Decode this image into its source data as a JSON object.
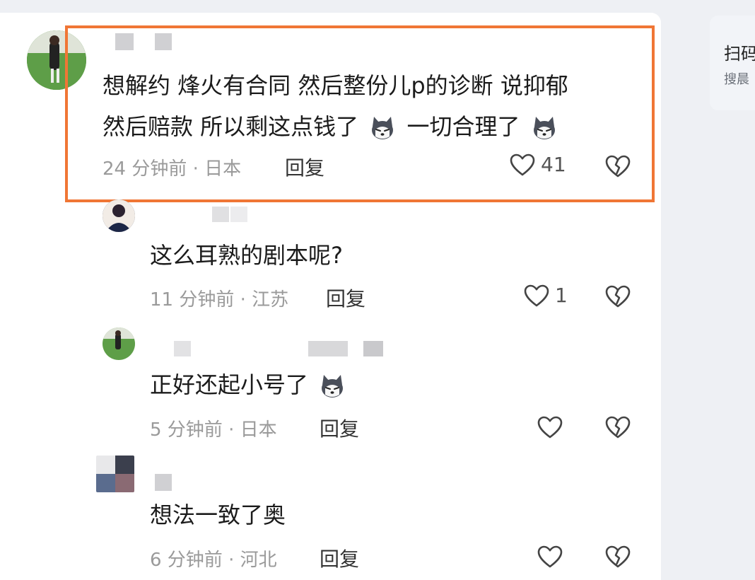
{
  "side_card": {
    "title": "扫码",
    "subtitle": "搜晨"
  },
  "comments": [
    {
      "text_line1": "想解约 烽火有合同 然后整份儿p的诊断 说抑郁",
      "text_line2a": "然后赔款 所以剩这点钱了",
      "text_line2b": "一切合理了",
      "time": "24 分钟前 · 日本",
      "reply": "回复",
      "likes": "41"
    },
    {
      "text": "这么耳熟的剧本呢?",
      "time": "11 分钟前 · 江苏",
      "reply": "回复",
      "likes": "1"
    },
    {
      "text": "正好还起小号了",
      "time": "5 分钟前 · 日本",
      "reply": "回复",
      "likes": ""
    },
    {
      "text": "想法一致了奥",
      "time": "6 分钟前 · 河北",
      "reply": "回复",
      "likes": ""
    }
  ],
  "colors": {
    "highlight": "#f07635",
    "icon": "#444444"
  }
}
